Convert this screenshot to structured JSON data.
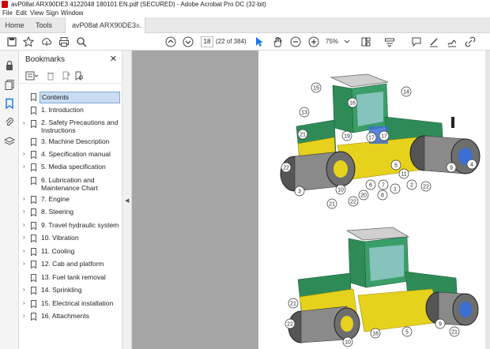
{
  "window": {
    "title": "avP08at ARX90DE3 4122048 180101 EN.pdf (SECURED) - Adobe Acrobat Pro DC (32-bit)"
  },
  "menu": [
    "File",
    "Edit",
    "View",
    "Sign",
    "Window"
  ],
  "tabs": {
    "home": "Home",
    "tools": "Tools",
    "document": "avP08at ARX90DE3...",
    "close_glyph": "×"
  },
  "toolbar": {
    "page_number": "18",
    "page_count": "(22 of 384)",
    "zoom": "75%"
  },
  "bookmarks": {
    "header": "Bookmarks",
    "close_glyph": "✕",
    "items": [
      {
        "label": "Contents",
        "expandable": false,
        "selected": true
      },
      {
        "label": "1. Introduction",
        "expandable": false
      },
      {
        "label": "2. Safety Precautions and",
        "label2": "Instructions",
        "expandable": true
      },
      {
        "label": "3. Machine Description",
        "expandable": false
      },
      {
        "label": "4. Specification manual",
        "expandable": true
      },
      {
        "label": "5. Media specification",
        "expandable": true
      },
      {
        "label": "6. Lubrication and",
        "label2": "Maintenance Chart",
        "expandable": false
      },
      {
        "label": "7. Engine",
        "expandable": true
      },
      {
        "label": "8. Steering",
        "expandable": true
      },
      {
        "label": "9. Travel hydraulic system",
        "expandable": true
      },
      {
        "label": "10. Vibration",
        "expandable": true
      },
      {
        "label": "11. Cooling",
        "expandable": true
      },
      {
        "label": "12. Cab and platform",
        "expandable": true
      },
      {
        "label": "13. Fuel tank removal",
        "expandable": false
      },
      {
        "label": "14. Sprinkling",
        "expandable": true
      },
      {
        "label": "15. Electrical installation",
        "expandable": true
      },
      {
        "label": "16. Attachments",
        "expandable": true
      }
    ]
  },
  "figure": {
    "callouts_top": [
      "15",
      "16",
      "14",
      "13",
      "21",
      "19",
      "17",
      "17",
      "4",
      "9",
      "22",
      "3",
      "10",
      "6",
      "7",
      "1",
      "2",
      "22",
      "11",
      "5",
      "20",
      "8",
      "22",
      "21"
    ],
    "callouts_bottom": [
      "21",
      "22",
      "10",
      "18",
      "5",
      "9",
      "21"
    ]
  },
  "colors": {
    "accent_blue": "#1a73e8",
    "machine_green": "#2e8b57",
    "machine_yellow": "#e6d21c",
    "selection": "#c9dcf1"
  }
}
